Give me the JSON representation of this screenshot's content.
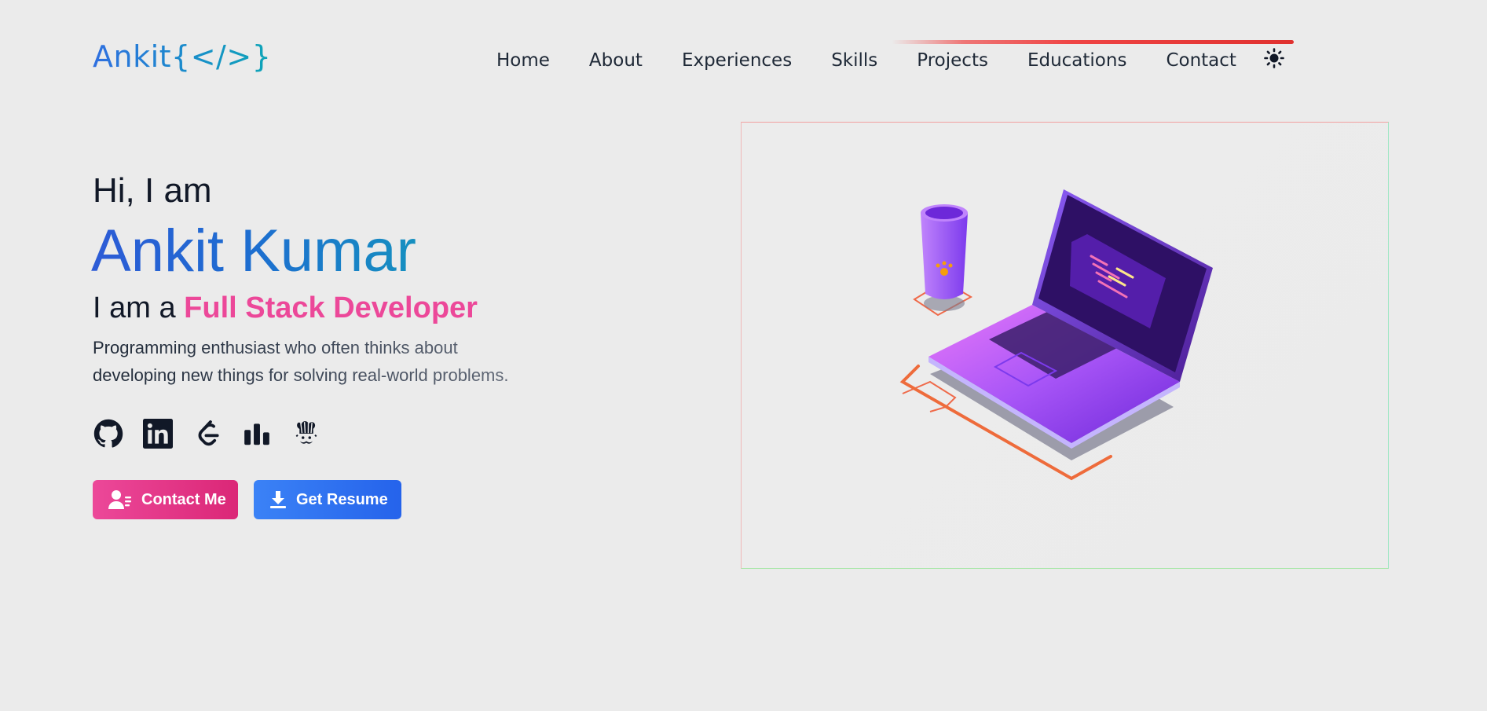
{
  "logo": {
    "text": "Ankit{</>}"
  },
  "nav": {
    "items": [
      "Home",
      "About",
      "Experiences",
      "Skills",
      "Projects",
      "Educations",
      "Contact"
    ],
    "theme_icon": "sun-icon"
  },
  "reading_progress": 0.67,
  "hero": {
    "greeting": "Hi, I am",
    "name": "Ankit Kumar",
    "role_prefix": "I am a ",
    "role": "Full Stack Developer",
    "bio_line1": "Programming enthusiast who often thinks about",
    "bio_line2": "developing new things for solving real-world problems."
  },
  "socials": [
    "github-icon",
    "linkedin-icon",
    "leetcode-icon",
    "stats-icon",
    "chef-icon"
  ],
  "buttons": {
    "contact": "Contact Me",
    "resume": "Get Resume"
  },
  "colors": {
    "background": "#ebebeb",
    "accent_pink": "#ec4899",
    "accent_blue": "#2563eb",
    "progress_red": "#ef4444"
  }
}
